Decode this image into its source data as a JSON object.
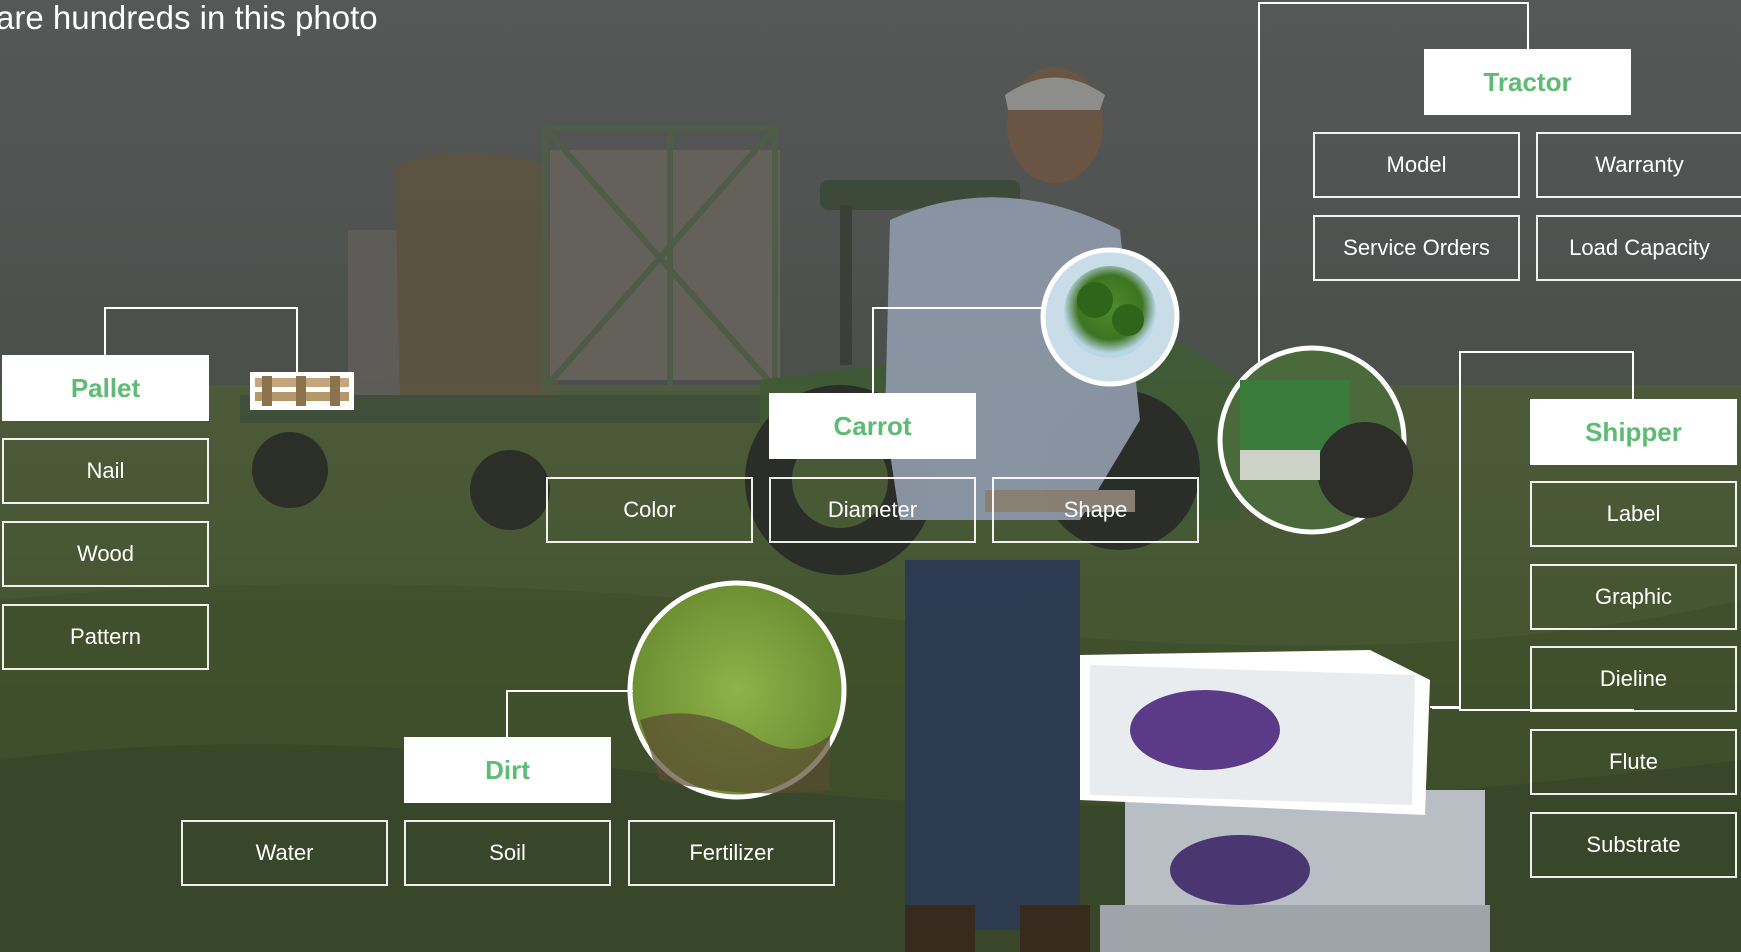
{
  "headline": "are hundreds in this photo",
  "colors": {
    "accent": "#5dbb74",
    "frame": "#ffffff",
    "overlay": "#3a4236"
  },
  "groups": {
    "tractor": {
      "title": "Tractor",
      "properties": [
        "Model",
        "Warranty",
        "Service Orders",
        "Load Capacity"
      ]
    },
    "pallet": {
      "title": "Pallet",
      "properties": [
        "Nail",
        "Wood",
        "Pattern"
      ]
    },
    "carrot": {
      "title": "Carrot",
      "properties": [
        "Color",
        "Diameter",
        "Shape"
      ]
    },
    "shipper": {
      "title": "Shipper",
      "properties": [
        "Label",
        "Graphic",
        "Dieline",
        "Flute",
        "Substrate"
      ]
    },
    "dirt": {
      "title": "Dirt",
      "properties": [
        "Water",
        "Soil",
        "Fertilizer"
      ]
    }
  }
}
